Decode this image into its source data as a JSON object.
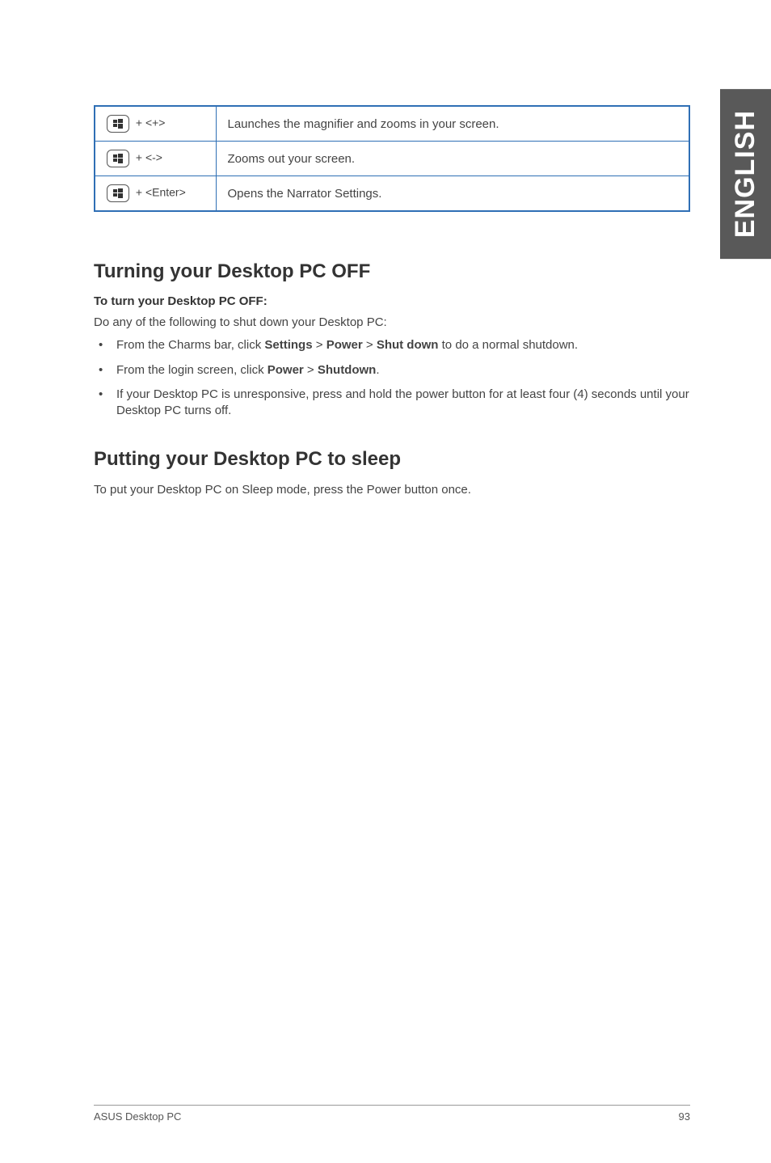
{
  "sideTab": "ENGLISH",
  "shortcuts": [
    {
      "keyText": " + <+>",
      "desc": "Launches the magnifier and zooms in your screen."
    },
    {
      "keyText": " + <->",
      "desc": "Zooms out your screen."
    },
    {
      "keyText": " + <Enter>",
      "desc": "Opens the Narrator Settings."
    }
  ],
  "sectionOff": {
    "heading": "Turning your Desktop PC OFF",
    "subheading": "To turn your Desktop PC OFF:",
    "intro": "Do any of the following to shut down your Desktop PC:",
    "bullets": {
      "b1_pre": "From the Charms bar, click ",
      "b1_s": "Settings",
      "b1_sep1": " > ",
      "b1_p": "Power",
      "b1_sep2": " > ",
      "b1_sd": "Shut down",
      "b1_post": " to do a normal shutdown.",
      "b2_pre": "From the login screen, click ",
      "b2_p": "Power",
      "b2_sep": " > ",
      "b2_sd": "Shutdown",
      "b2_post": ".",
      "b3": "If your Desktop PC is unresponsive, press and hold the power  button for at least four (4) seconds until your Desktop PC turns off."
    }
  },
  "sectionSleep": {
    "heading": "Putting your Desktop PC to sleep",
    "para": "To put your Desktop PC on Sleep mode, press the Power button once."
  },
  "footer": {
    "left": "ASUS Desktop PC",
    "right": "93"
  }
}
